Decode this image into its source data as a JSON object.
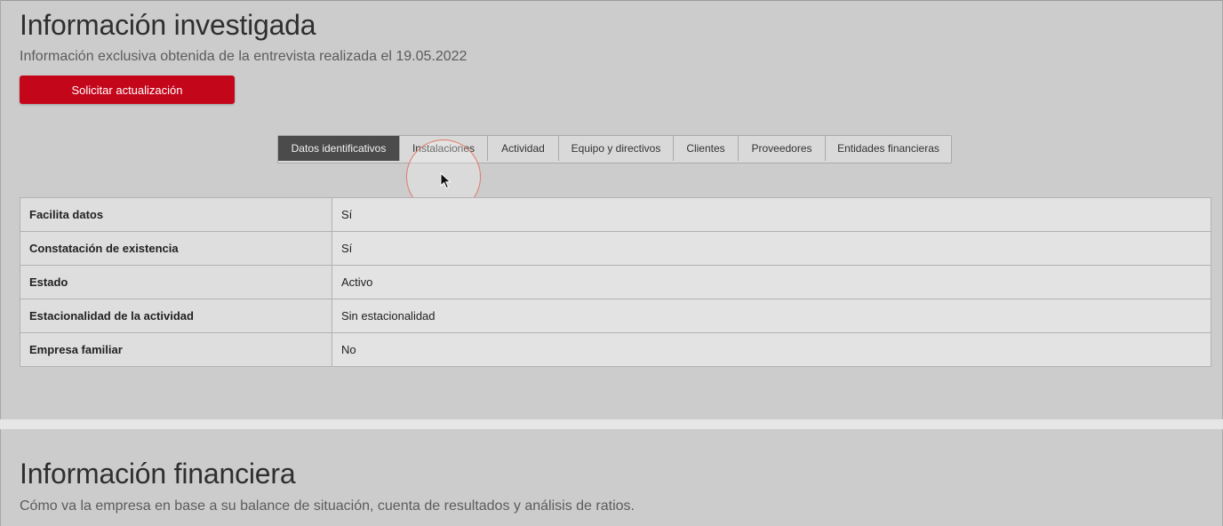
{
  "investigated": {
    "title": "Información investigada",
    "subtitle": "Información exclusiva obtenida de la entrevista realizada el 19.05.2022",
    "update_button": "Solicitar actualización",
    "tabs": [
      {
        "label": "Datos identificativos",
        "active": true
      },
      {
        "label": "Instalaciones",
        "active": false
      },
      {
        "label": "Actividad",
        "active": false
      },
      {
        "label": "Equipo y directivos",
        "active": false
      },
      {
        "label": "Clientes",
        "active": false
      },
      {
        "label": "Proveedores",
        "active": false
      },
      {
        "label": "Entidades financieras",
        "active": false
      }
    ],
    "rows": [
      {
        "label": "Facilita datos",
        "value": "Sí"
      },
      {
        "label": "Constatación de existencia",
        "value": "Sí"
      },
      {
        "label": "Estado",
        "value": "Activo"
      },
      {
        "label": "Estacionalidad de la actividad",
        "value": "Sin estacionalidad"
      },
      {
        "label": "Empresa familiar",
        "value": "No"
      }
    ]
  },
  "financial": {
    "title": "Información financiera",
    "subtitle": "Cómo va la empresa en base a su balance de situación, cuenta de resultados y análisis de ratios."
  },
  "colors": {
    "page_background": "#cccccc",
    "accent_button": "#c4061b",
    "active_tab": "#4b4b4b",
    "cursor_ring": "#e07a68"
  },
  "icons": {
    "cursor": "mouse-pointer-icon"
  }
}
